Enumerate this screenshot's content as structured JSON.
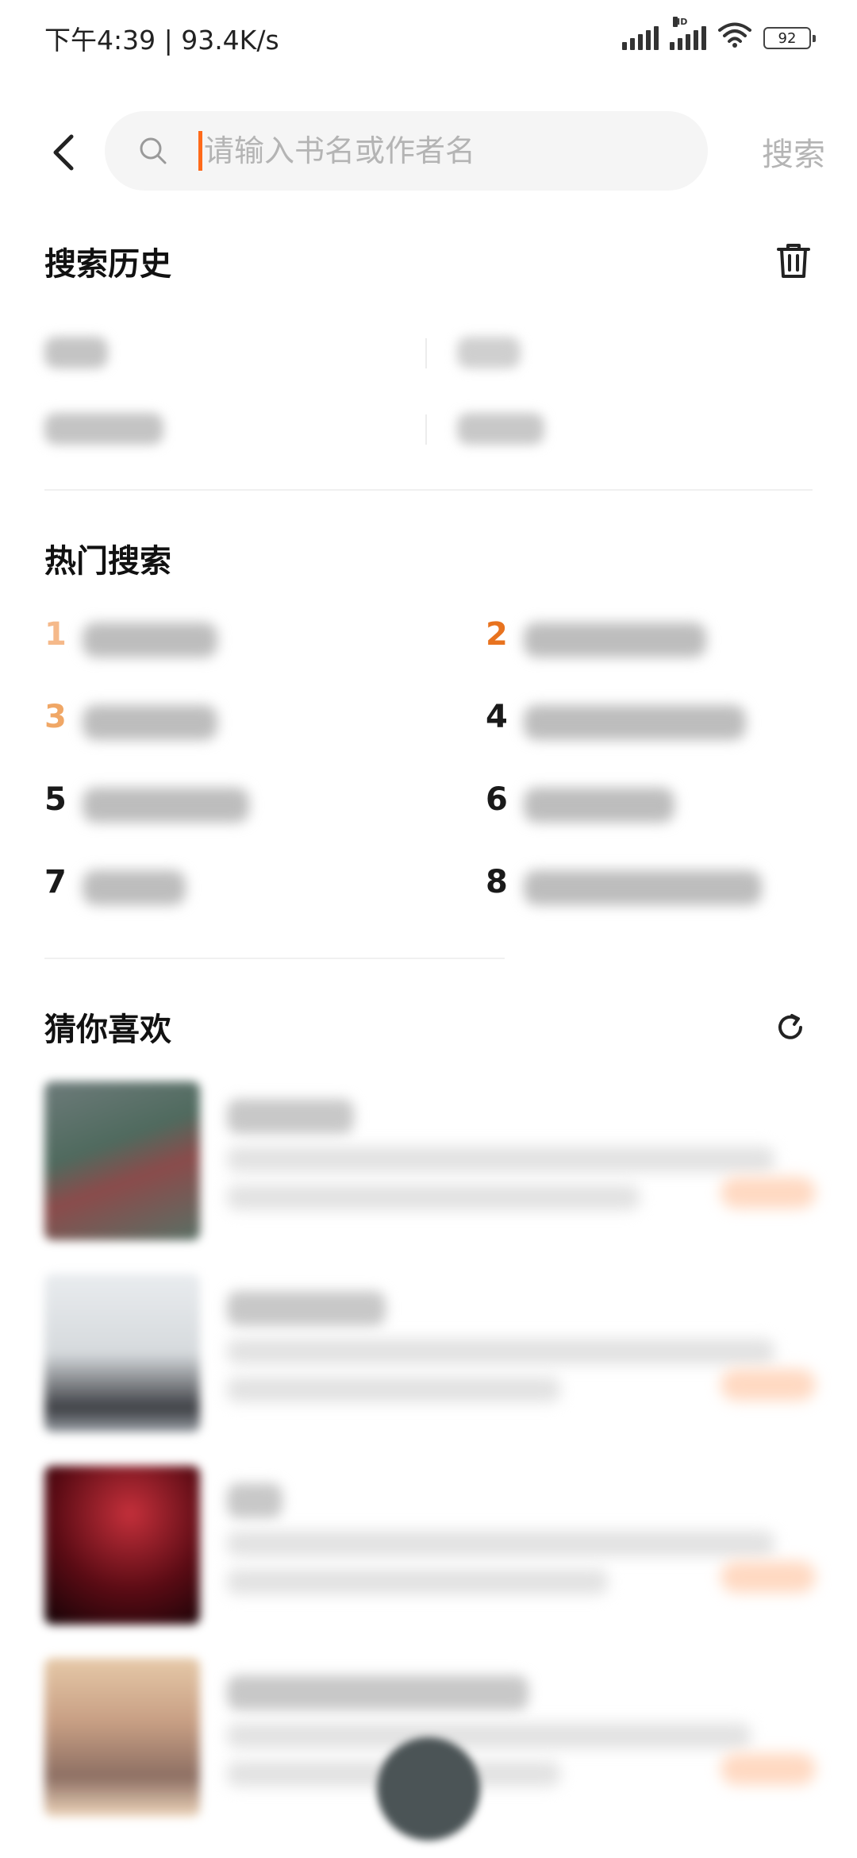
{
  "status_bar": {
    "time_speed": "下午4:39 | 93.4K/s",
    "hd_label": "HD",
    "battery": "92"
  },
  "search": {
    "placeholder": "请输入书名或作者名",
    "button_label": "搜索"
  },
  "history": {
    "title": "搜索历史"
  },
  "hot": {
    "title": "热门搜索",
    "items": [
      {
        "rank": "1",
        "color": "#f5b98a"
      },
      {
        "rank": "2",
        "color": "#e8731f"
      },
      {
        "rank": "3",
        "color": "#f0a766"
      },
      {
        "rank": "4",
        "color": "#1a1a1a"
      },
      {
        "rank": "5",
        "color": "#1a1a1a"
      },
      {
        "rank": "6",
        "color": "#1a1a1a"
      },
      {
        "rank": "7",
        "color": "#1a1a1a"
      },
      {
        "rank": "8",
        "color": "#1a1a1a"
      }
    ]
  },
  "recommend": {
    "title": "猜你喜欢"
  },
  "colors": {
    "accent": "#ff6a1a",
    "placeholder": "#b4b4b4"
  }
}
